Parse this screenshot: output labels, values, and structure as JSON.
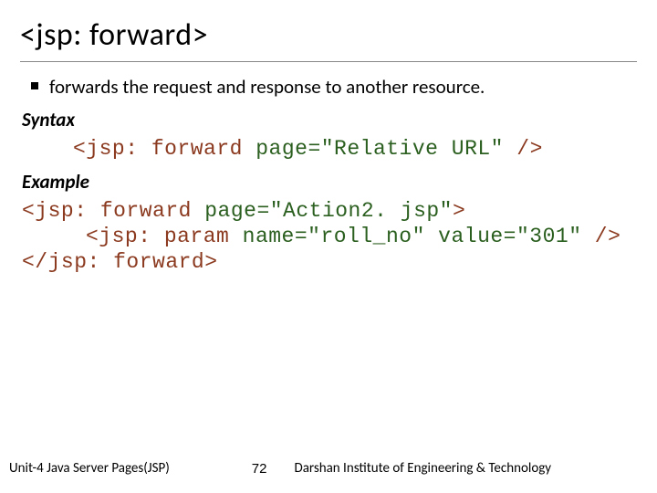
{
  "title": "<jsp: forward>",
  "bullet": "forwards the request and response to another resource.",
  "syntax_label": "Syntax",
  "syntax": {
    "open": "<jsp: forward ",
    "attr": "page=\"Relative URL\"",
    "close": " />"
  },
  "example_label": "Example",
  "example": {
    "l1_open": "<jsp: forward ",
    "l1_attr": "page=\"Action2. jsp\"",
    "l1_close": ">",
    "l2_open": "<jsp: param ",
    "l2_attr": "name=\"roll_no\" value=\"301\"",
    "l2_close": " />",
    "l3": "</jsp: forward>"
  },
  "footer": {
    "left": "Unit-4 Java Server Pages(JSP)",
    "page": "72",
    "right": "Darshan Institute of Engineering & Technology"
  }
}
